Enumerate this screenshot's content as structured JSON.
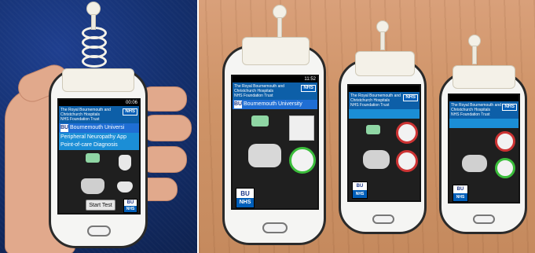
{
  "phone_left": {
    "status_time": "00:06",
    "hospital_line1": "The Royal Bournemouth and",
    "hospital_line2": "Christchurch Hospitals",
    "hospital_line3": "NHS Foundation Trust",
    "nhs_badge": "NHS",
    "university": "Bournemouth Universi",
    "bu_logo": "BU",
    "app_title_line1": "Peripheral Neuropathy App",
    "app_title_line2": "Point-of-care Diagnosis",
    "start_button": "Start Test",
    "logo_bu": "BU",
    "logo_nhs": "NHS"
  },
  "phone_center": {
    "status_time": "11:52",
    "hospital_line1": "The Royal Bournemouth and",
    "hospital_line2": "Christchurch Hospitals",
    "hospital_line3": "NHS Foundation Trust",
    "nhs_badge": "NHS",
    "university": "Bournemouth University",
    "bu_logo": "BU",
    "logo_bu": "BU",
    "logo_nhs": "NHS"
  },
  "phone_right_mid": {
    "hospital_line1": "The Royal Bournemouth and",
    "hospital_line2": "Christchurch Hospitals",
    "hospital_line3": "NHS Foundation Trust",
    "nhs_badge": "NHS",
    "logo_bu": "BU",
    "logo_nhs": "NHS"
  },
  "phone_right_small": {
    "hospital_line1": "The Royal Bournemouth and",
    "hospital_line2": "Christchurch Hospitals",
    "hospital_line3": "NHS Foundation Trust",
    "nhs_badge": "NHS",
    "logo_bu": "BU",
    "logo_nhs": "NHS"
  },
  "colors": {
    "nhs_blue": "#005eb8",
    "bu_blue": "#1f6ed4",
    "app_blue": "#1b8ed6",
    "carpet_blue": "#14306f",
    "wood": "#cf9468"
  }
}
